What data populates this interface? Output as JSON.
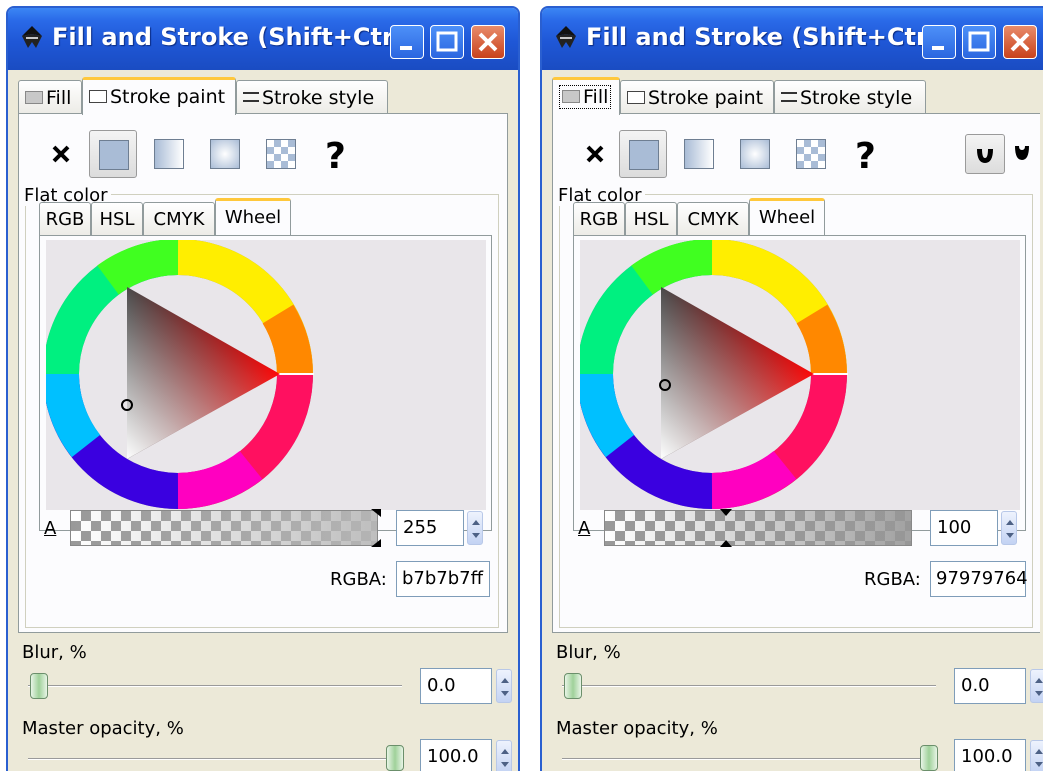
{
  "windows": [
    {
      "title": "Fill and Stroke (Shift+Ctr...",
      "tabs": [
        "Fill",
        "Stroke paint",
        "Stroke style"
      ],
      "active_tab": "Stroke paint",
      "paint_buttons": [
        "x-icon",
        "flat-color-icon",
        "linear-gradient-icon",
        "radial-gradient-icon",
        "pattern-icon",
        "question-icon"
      ],
      "section_label": "Flat color",
      "color_tabs": [
        "RGB",
        "HSL",
        "CMYK",
        "Wheel"
      ],
      "active_color_tab": "Wheel",
      "alpha_label": "A",
      "alpha_value": "255",
      "rgba_label": "RGBA:",
      "rgba_value": "b7b7b7ff",
      "blur_label": "Blur, %",
      "blur_value": "0.0",
      "opacity_label": "Master opacity, %",
      "opacity_value": "100.0"
    },
    {
      "title": "Fill and Stroke (Shift+Ctr...",
      "tabs": [
        "Fill",
        "Stroke paint",
        "Stroke style"
      ],
      "active_tab": "Fill",
      "paint_buttons": [
        "x-icon",
        "flat-color-icon",
        "linear-gradient-icon",
        "radial-gradient-icon",
        "pattern-icon",
        "question-icon",
        "fill-rule-evenodd-icon",
        "fill-rule-nonzero-icon"
      ],
      "section_label": "Flat color",
      "color_tabs": [
        "RGB",
        "HSL",
        "CMYK",
        "Wheel"
      ],
      "active_color_tab": "Wheel",
      "alpha_label": "A",
      "alpha_value": "100",
      "rgba_label": "RGBA:",
      "rgba_value": "97979764",
      "blur_label": "Blur, %",
      "blur_value": "0.0",
      "opacity_label": "Master opacity, %",
      "opacity_value": "100.0"
    }
  ],
  "colors": {
    "titlebar": "#2a6ae8",
    "tab_highlight": "#ffc83c",
    "window_bg": "#ece9d8",
    "wheel_bg": "#e9e6ea"
  }
}
